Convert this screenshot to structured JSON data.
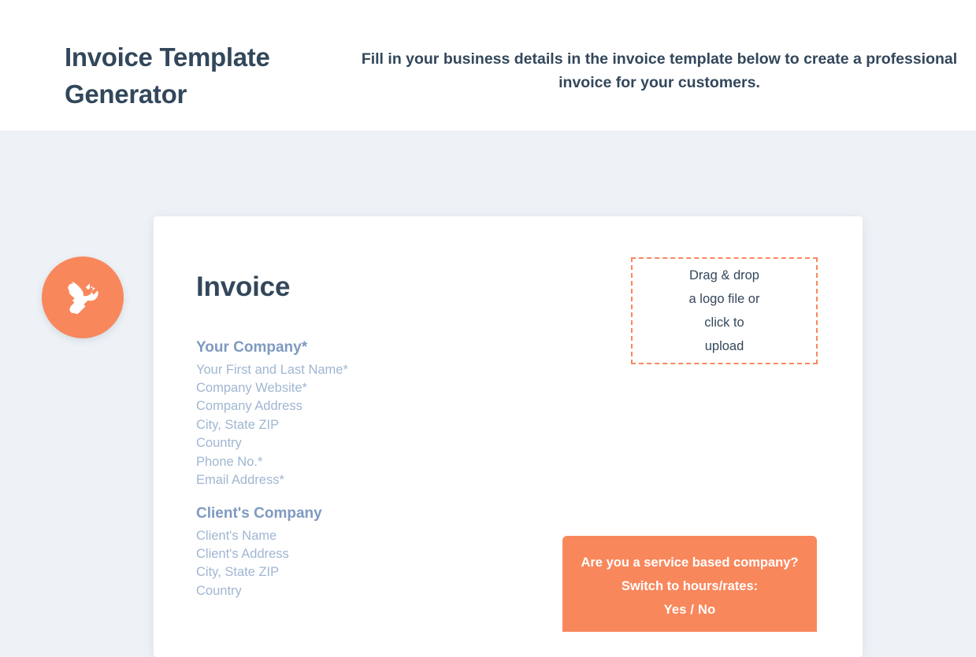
{
  "header": {
    "title": "Invoice Template Generator",
    "subtitle": "Fill in your business details in the invoice template below to create a professional invoice for your customers."
  },
  "badge": {
    "icon": "paintbrush-wrench-icon",
    "color": "#f9875c"
  },
  "card": {
    "heading": "Invoice",
    "your_company": {
      "title": "Your Company*",
      "fields": [
        "Your First and Last Name*",
        "Company Website*",
        "Company Address",
        "City, State ZIP",
        "Country",
        "Phone No.*",
        "Email Address*"
      ]
    },
    "client_company": {
      "title": "Client's Company",
      "fields": [
        "Client's Name",
        "Client's Address",
        "City, State ZIP",
        "Country"
      ]
    },
    "logo_dropzone": {
      "lines": [
        "Drag & drop",
        "a logo file or",
        "click to",
        "upload"
      ],
      "border_color": "#f9875c"
    },
    "service_banner": {
      "lines": [
        "Are you a service based company?",
        "Switch to hours/rates:"
      ],
      "choice": "Yes / No",
      "background": "#f9875c"
    }
  },
  "colors": {
    "page_background": "#eef2f6",
    "heading_navy": "#33475b",
    "label_blue": "#7f9ac0",
    "field_blue": "#a0b6d2",
    "accent_orange": "#f9875c"
  }
}
